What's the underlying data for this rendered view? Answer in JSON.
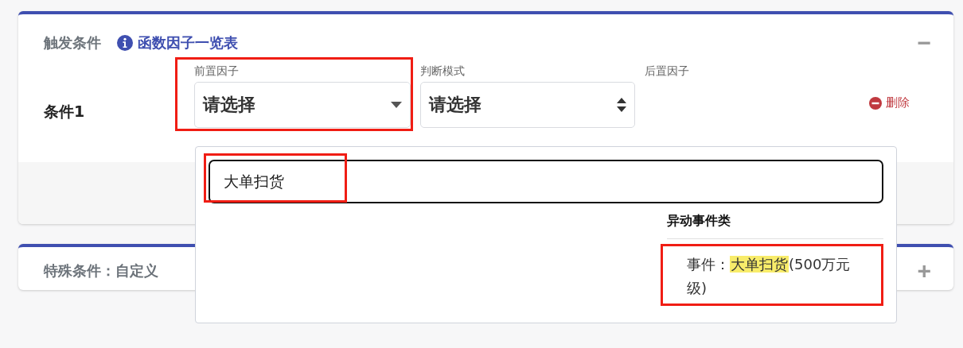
{
  "trigger_card": {
    "title": "触发条件",
    "link": "函数因子一览表",
    "collapse_symbol": "−",
    "condition": {
      "label": "条件1",
      "fields": [
        {
          "label": "前置因子",
          "kind": "dropdown",
          "value": "请选择",
          "highlighted": true
        },
        {
          "label": "判断模式",
          "kind": "select",
          "value": "请选择",
          "highlighted": false
        },
        {
          "label": "后置因子",
          "kind": "empty",
          "highlighted": false
        }
      ],
      "delete_label": "删除"
    }
  },
  "dropdown": {
    "search": {
      "value": "大单扫货",
      "highlighted": true
    },
    "group": "异动事件类",
    "options": [
      {
        "prefix": "事件：",
        "match": "大单扫货",
        "suffix": "(500万元级)",
        "highlighted": true
      }
    ]
  },
  "special_card": {
    "title": "特殊条件：自定义",
    "expand_symbol": "+"
  }
}
